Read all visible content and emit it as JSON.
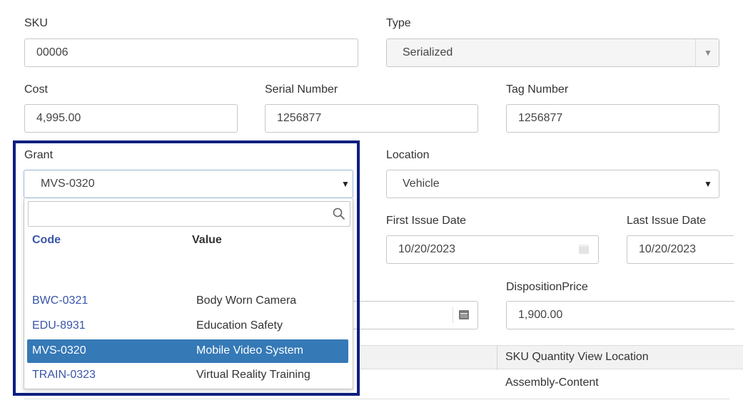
{
  "form": {
    "sku": {
      "label": "SKU",
      "value": "00006"
    },
    "type": {
      "label": "Type",
      "value": "Serialized"
    },
    "cost": {
      "label": "Cost",
      "value": "4,995.00"
    },
    "serial_number": {
      "label": "Serial Number",
      "value": "1256877"
    },
    "tag_number": {
      "label": "Tag Number",
      "value": "1256877"
    },
    "grant": {
      "label": "Grant",
      "value": "MVS-0320"
    },
    "location": {
      "label": "Location",
      "value": "Vehicle"
    },
    "first_issue_date": {
      "label": "First Issue Date",
      "value": "10/20/2023"
    },
    "last_issue_date": {
      "label": "Last Issue Date",
      "value": "10/20/2023"
    },
    "disposition_price": {
      "label": "DispositionPrice",
      "value": "1,900.00"
    }
  },
  "grant_dropdown": {
    "search_value": "",
    "columns": {
      "code": "Code",
      "value": "Value"
    },
    "options": [
      {
        "code": "BWC-0321",
        "value": "Body Worn Camera",
        "selected": false
      },
      {
        "code": "EDU-8931",
        "value": "Education Safety",
        "selected": false
      },
      {
        "code": "MVS-0320",
        "value": "Mobile Video System",
        "selected": true
      },
      {
        "code": "TRAIN-0323",
        "value": "Virtual Reality Training",
        "selected": false
      }
    ]
  },
  "grid": {
    "column_header": "SKU Quantity View Location",
    "rows": [
      {
        "location": "Assembly-Content"
      }
    ]
  },
  "icons": {
    "caret": "caret-down-icon",
    "search": "search-icon",
    "calendar": "calendar-icon"
  },
  "colors": {
    "selected_row": "#3579b6",
    "code_link": "#3a55a8",
    "highlight_frame": "#0c1e80",
    "input_border": "#c7c7c7"
  }
}
